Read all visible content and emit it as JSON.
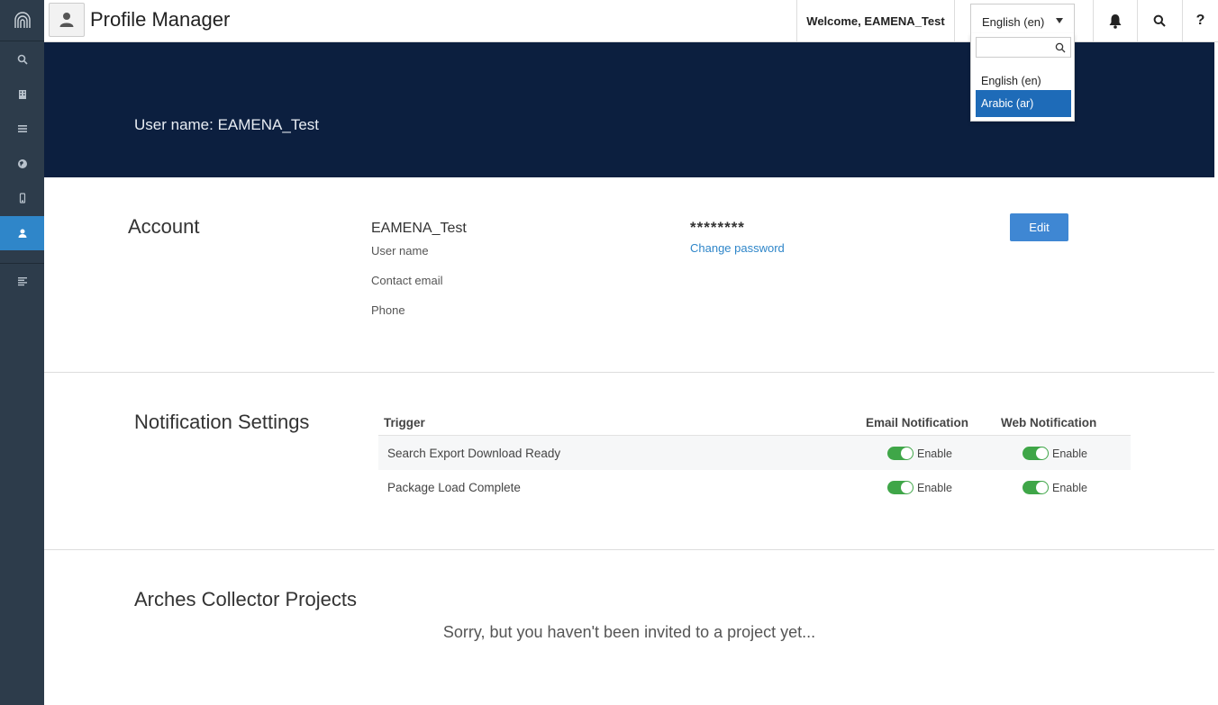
{
  "header": {
    "title": "Profile Manager",
    "welcome": "Welcome, EAMENA_Test",
    "language": "English (en)"
  },
  "language_dropdown": {
    "search_placeholder": "",
    "options": [
      "English (en)",
      "Arabic (ar)"
    ],
    "highlighted": "Arabic (ar)"
  },
  "sidebar": {
    "items": [
      "search-icon",
      "building-icon",
      "list-icon",
      "globe-icon",
      "mobile-icon",
      "user-icon",
      "menu-icon"
    ],
    "active": "user-icon",
    "active_color": "#2f86c9"
  },
  "banner": {
    "username_text": "User name: EAMENA_Test"
  },
  "account": {
    "heading": "Account",
    "name": "EAMENA_Test",
    "labels": [
      "User name",
      "Contact email",
      "Phone"
    ],
    "password": "********",
    "change_password": "Change password",
    "edit": "Edit"
  },
  "notifications": {
    "heading": "Notification Settings",
    "columns": [
      "Trigger",
      "Email Notification",
      "Web Notification"
    ],
    "rows": [
      {
        "trigger": "Search Export Download Ready",
        "email": "Enable",
        "web": "Enable"
      },
      {
        "trigger": "Package Load Complete",
        "email": "Enable",
        "web": "Enable"
      }
    ]
  },
  "projects": {
    "heading": "Arches Collector Projects",
    "empty_message": "Sorry, but you haven't been invited to a project yet..."
  }
}
